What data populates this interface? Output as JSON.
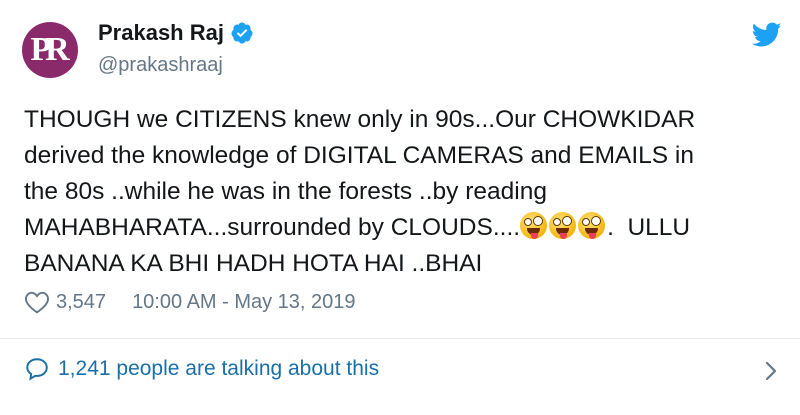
{
  "author": {
    "name": "Prakash Raj",
    "handle": "@prakashraaj",
    "avatar_text": "PR",
    "avatar_color": "#8b2a6b",
    "verified_icon": "verified-badge-icon"
  },
  "tweet": {
    "line1": "THOUGH we CITIZENS knew only in 90s...Our CHOWKIDAR",
    "line2": "derived the knowledge of DIGITAL CAMERAS and EMAILS in",
    "line3": "the 80s ..while he was in the forests ..by reading",
    "line4_before_emoji": "MAHABHARATA...surrounded by CLOUDS....",
    "emoji_name": "zany-face-emoji",
    "emoji_count": 3,
    "line4_after_emoji": ".  ULLU",
    "line5": "BANANA KA BHI HADH HOTA HAI ..BHAI"
  },
  "meta": {
    "likes": "3,547",
    "timestamp": "10:00 AM - May 13, 2019",
    "heart_icon": "heart-icon"
  },
  "footer": {
    "talking_text": "1,241 people are talking about this",
    "bubble_icon": "comment-bubble-icon",
    "chevron_icon": "chevron-right-icon"
  },
  "colors": {
    "twitter_blue": "#1da1f2",
    "link_blue": "#1b6fa8",
    "muted": "#657786"
  }
}
